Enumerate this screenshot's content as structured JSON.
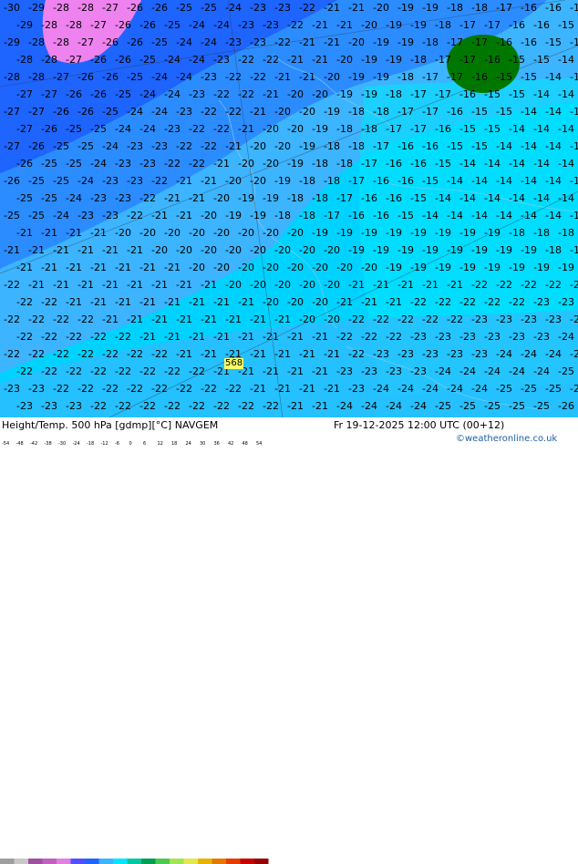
{
  "map": {
    "temperature_labels": [
      "-30",
      "-29",
      "-28",
      "-27",
      "-26",
      "-25",
      "-24",
      "-23",
      "-22",
      "-21",
      "-20",
      "-19",
      "-18",
      "-17",
      "-16",
      "-15",
      "-14"
    ],
    "highlight_value": "568",
    "colors": {
      "magenta": "#ee82ee",
      "blue_dark": "#1e64ff",
      "blue_mid": "#2b8cff",
      "blue_light": "#3cb4ff",
      "cyan": "#00d2ff",
      "cyan_light": "#00e6ff",
      "green_dark": "#007800",
      "highlight_bg": "#ffff66"
    }
  },
  "footer": {
    "title": "Height/Temp. 500 hPa [gdmp][°C] NAVGEM",
    "datetime": "Fr 19-12-2025 12:00 UTC (00+12)",
    "copyright": "©weatheronline.co.uk",
    "legend_values": [
      "-54",
      "-48",
      "-42",
      "-38",
      "-30",
      "-24",
      "-18",
      "-12",
      "-6",
      "0",
      "6",
      "12",
      "18",
      "24",
      "30",
      "36",
      "42",
      "48",
      "54"
    ],
    "legend_colors": [
      "#9e9e9e",
      "#c8c8c8",
      "#a050a0",
      "#c060c0",
      "#e080e0",
      "#5050ff",
      "#1e64ff",
      "#3cb4ff",
      "#00e6ff",
      "#00c8a0",
      "#00a050",
      "#50c850",
      "#a0e650",
      "#e6e650",
      "#e6b400",
      "#e67800",
      "#e63c00",
      "#c80000",
      "#960000"
    ]
  }
}
